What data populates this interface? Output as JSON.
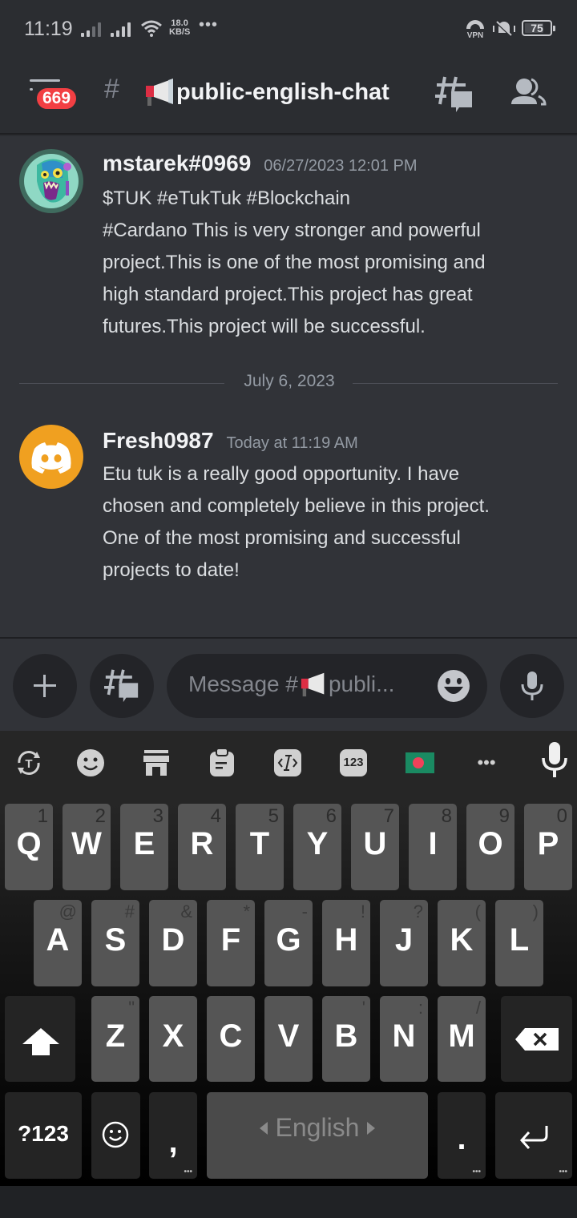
{
  "status_bar": {
    "time": "11:19",
    "net_speed_value": "18.0",
    "net_speed_unit": "KB/S",
    "overflow": "•••",
    "vpn_label": "VPN",
    "battery_level": "75",
    "battery_fraction": 0.75
  },
  "header": {
    "unread_badge": "669",
    "channel_hash": "#",
    "channel_name": "public-english-chat",
    "icons": [
      "menu-icon",
      "megaphone-emoji",
      "threads-icon",
      "members-icon"
    ]
  },
  "messages": [
    {
      "username": "mstarek#0969",
      "timestamp": "06/27/2023 12:01 PM",
      "avatar": "zombie-avatar",
      "lines": [
        "$TUK #eTukTuk #Blockchain",
        "#Cardano  This is very stronger and powerful",
        "project.This is one of the most promising and",
        "high standard project.This project has great",
        "futures.This project will be successful."
      ]
    },
    {
      "username": "Fresh0987",
      "timestamp": "Today at 11:19 AM",
      "avatar": "discord-default-avatar",
      "avatar_color": "#f0a020",
      "lines": [
        "Etu tuk is a really good opportunity. I have",
        "chosen and completely believe in this project.",
        "One of the most promising and successful",
        "projects to date!"
      ]
    }
  ],
  "date_divider": "July 6, 2023",
  "composer": {
    "placeholder_prefix": "Message #",
    "placeholder_suffix": "publi..."
  },
  "keyboard": {
    "toolbar": [
      "text-translate-icon",
      "sticker-icon",
      "store-icon",
      "clipboard-icon",
      "text-edit-icon",
      "numpad-icon",
      "bangladesh-flag-icon",
      "more-icon",
      "voice-input-icon"
    ],
    "numpad_label": "123",
    "toolbar_more": "•••",
    "row1": [
      {
        "key": "Q",
        "hint": "1"
      },
      {
        "key": "W",
        "hint": "2"
      },
      {
        "key": "E",
        "hint": "3"
      },
      {
        "key": "R",
        "hint": "4"
      },
      {
        "key": "T",
        "hint": "5"
      },
      {
        "key": "Y",
        "hint": "6"
      },
      {
        "key": "U",
        "hint": "7"
      },
      {
        "key": "I",
        "hint": "8"
      },
      {
        "key": "O",
        "hint": "9"
      },
      {
        "key": "P",
        "hint": "0"
      }
    ],
    "row2": [
      {
        "key": "A",
        "hint": "@"
      },
      {
        "key": "S",
        "hint": "#"
      },
      {
        "key": "D",
        "hint": "&"
      },
      {
        "key": "F",
        "hint": "*"
      },
      {
        "key": "G",
        "hint": "-"
      },
      {
        "key": "H",
        "hint": "!"
      },
      {
        "key": "J",
        "hint": "?"
      },
      {
        "key": "K",
        "hint": "("
      },
      {
        "key": "L",
        "hint": ")"
      }
    ],
    "row3": [
      {
        "key": "Z",
        "hint": "\""
      },
      {
        "key": "X",
        "hint": ""
      },
      {
        "key": "C",
        "hint": ""
      },
      {
        "key": "V",
        "hint": ""
      },
      {
        "key": "B",
        "hint": "'"
      },
      {
        "key": "N",
        "hint": ":"
      },
      {
        "key": "M",
        "hint": "/"
      }
    ],
    "symbols_label": "?123",
    "comma": ",",
    "period": ".",
    "space_label": "English",
    "more_dots": "•••"
  },
  "colors": {
    "background": "#313338",
    "header_bg": "#2b2d31",
    "badge_red": "#f23f43",
    "avatar_orange": "#f0a020"
  }
}
